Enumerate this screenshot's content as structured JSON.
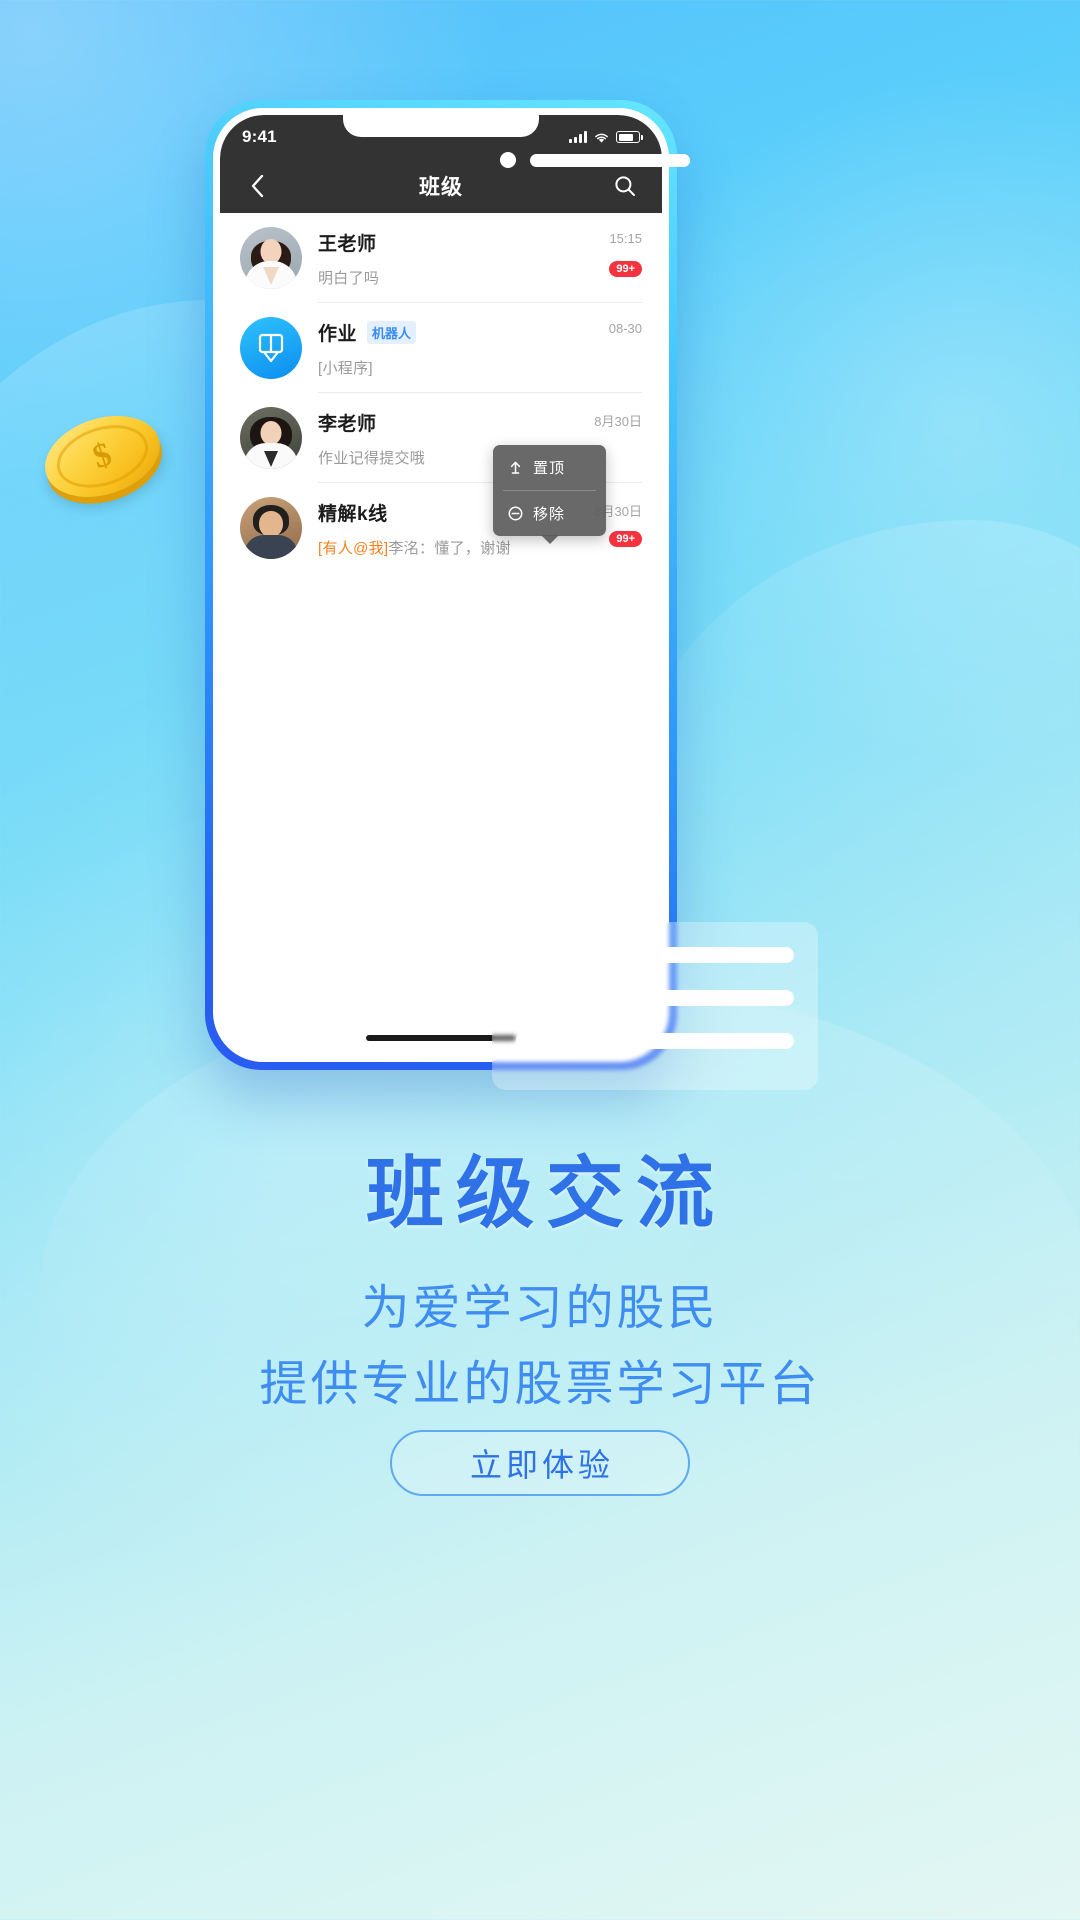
{
  "background": {
    "accent": "#2f72e8",
    "brand_blue": "#3f8df0"
  },
  "coin": {
    "symbol": "$",
    "name": "gold-coin"
  },
  "phone": {
    "status_bar": {
      "time": "9:41",
      "signal_icon": "cellular-signal-icon",
      "wifi_icon": "wifi-icon",
      "battery_icon": "battery-icon"
    },
    "nav_bar": {
      "back_icon": "chevron-left-icon",
      "title": "班级",
      "search_icon": "search-icon"
    },
    "chat_rows": [
      {
        "avatar": "avatar-wang-teacher",
        "name": "王老师",
        "badge": "",
        "message": "明白了吗",
        "message_prefix": "",
        "time": "15:15",
        "unread": "99+"
      },
      {
        "avatar": "avatar-homework-robot",
        "name": "作业",
        "badge": "机器人",
        "message": "[小程序]",
        "message_prefix": "",
        "time": "08-30",
        "unread": ""
      },
      {
        "avatar": "avatar-li-teacher",
        "name": "李老师",
        "badge": "",
        "message": "作业记得提交哦",
        "message_prefix": "",
        "time": "8月30日",
        "unread": ""
      },
      {
        "avatar": "avatar-kline-group",
        "name": "精解k线",
        "badge": "",
        "message": "李洺：懂了，谢谢",
        "message_prefix": "[有人@我]",
        "time": "8月30日",
        "unread": "99+"
      }
    ],
    "context_menu": {
      "items": [
        {
          "icon": "pin-top-icon",
          "label": "置顶"
        },
        {
          "icon": "remove-circle-icon",
          "label": "移除"
        }
      ]
    },
    "home_indicator": "home-indicator"
  },
  "marketing": {
    "headline": "班级交流",
    "subline1": "为爱学习的股民",
    "subline2": "提供专业的股票学习平台",
    "cta_label": "立即体验"
  }
}
